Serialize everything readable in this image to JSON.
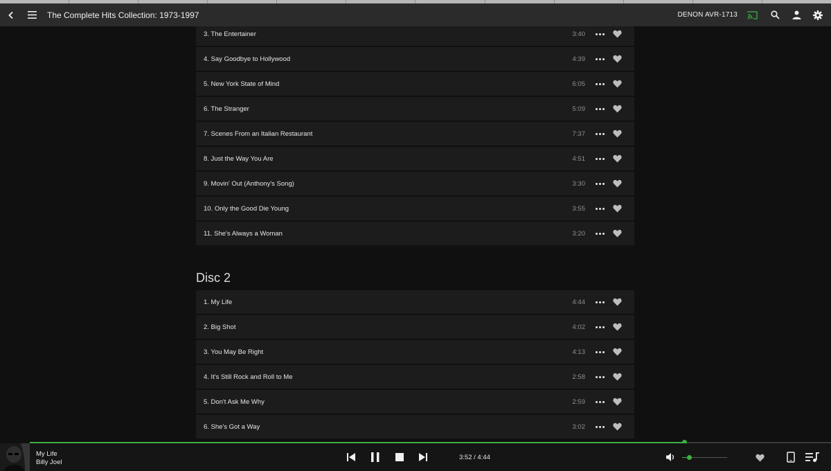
{
  "header": {
    "album_title": "The Complete Hits Collection: 1973-1997",
    "device_name": "DENON AVR-1713",
    "accent_color": "#3cb043"
  },
  "disc1_tracks": [
    {
      "label": "3. The Entertainer",
      "duration": "3:40"
    },
    {
      "label": "4. Say Goodbye to Hollywood",
      "duration": "4:39"
    },
    {
      "label": "5. New York State of Mind",
      "duration": "6:05"
    },
    {
      "label": "6. The Stranger",
      "duration": "5:09"
    },
    {
      "label": "7. Scenes From an Italian Restaurant",
      "duration": "7:37"
    },
    {
      "label": "8. Just the Way You Are",
      "duration": "4:51"
    },
    {
      "label": "9. Movin' Out (Anthony's Song)",
      "duration": "3:30"
    },
    {
      "label": "10. Only the Good Die Young",
      "duration": "3:55"
    },
    {
      "label": "11. She's Always a Woman",
      "duration": "3:20"
    }
  ],
  "disc2": {
    "title": "Disc 2",
    "tracks": [
      {
        "label": "1. My Life",
        "duration": "4:44"
      },
      {
        "label": "2. Big Shot",
        "duration": "4:02"
      },
      {
        "label": "3. You May Be Right",
        "duration": "4:13"
      },
      {
        "label": "4. It's Still Rock and Roll to Me",
        "duration": "2:58"
      },
      {
        "label": "5. Don't Ask Me Why",
        "duration": "2:59"
      },
      {
        "label": "6. She's Got a Way",
        "duration": "3:02"
      }
    ]
  },
  "now_playing": {
    "title": "My Life",
    "artist": "Billy Joel",
    "time": "3:52 / 4:44",
    "progress_fraction": 0.817,
    "volume_fraction": 0.15
  },
  "icons": {
    "back": "chevron-left-icon",
    "menu": "hamburger-menu-icon",
    "cast": "cast-icon",
    "search": "search-icon",
    "account": "person-icon",
    "settings": "gear-icon",
    "more": "more-dots-icon",
    "favorite": "heart-icon",
    "previous": "skip-previous-icon",
    "pause": "pause-icon",
    "stop": "stop-icon",
    "next": "skip-next-icon",
    "volume": "volume-icon",
    "device": "tablet-icon",
    "queue": "queue-music-icon"
  }
}
